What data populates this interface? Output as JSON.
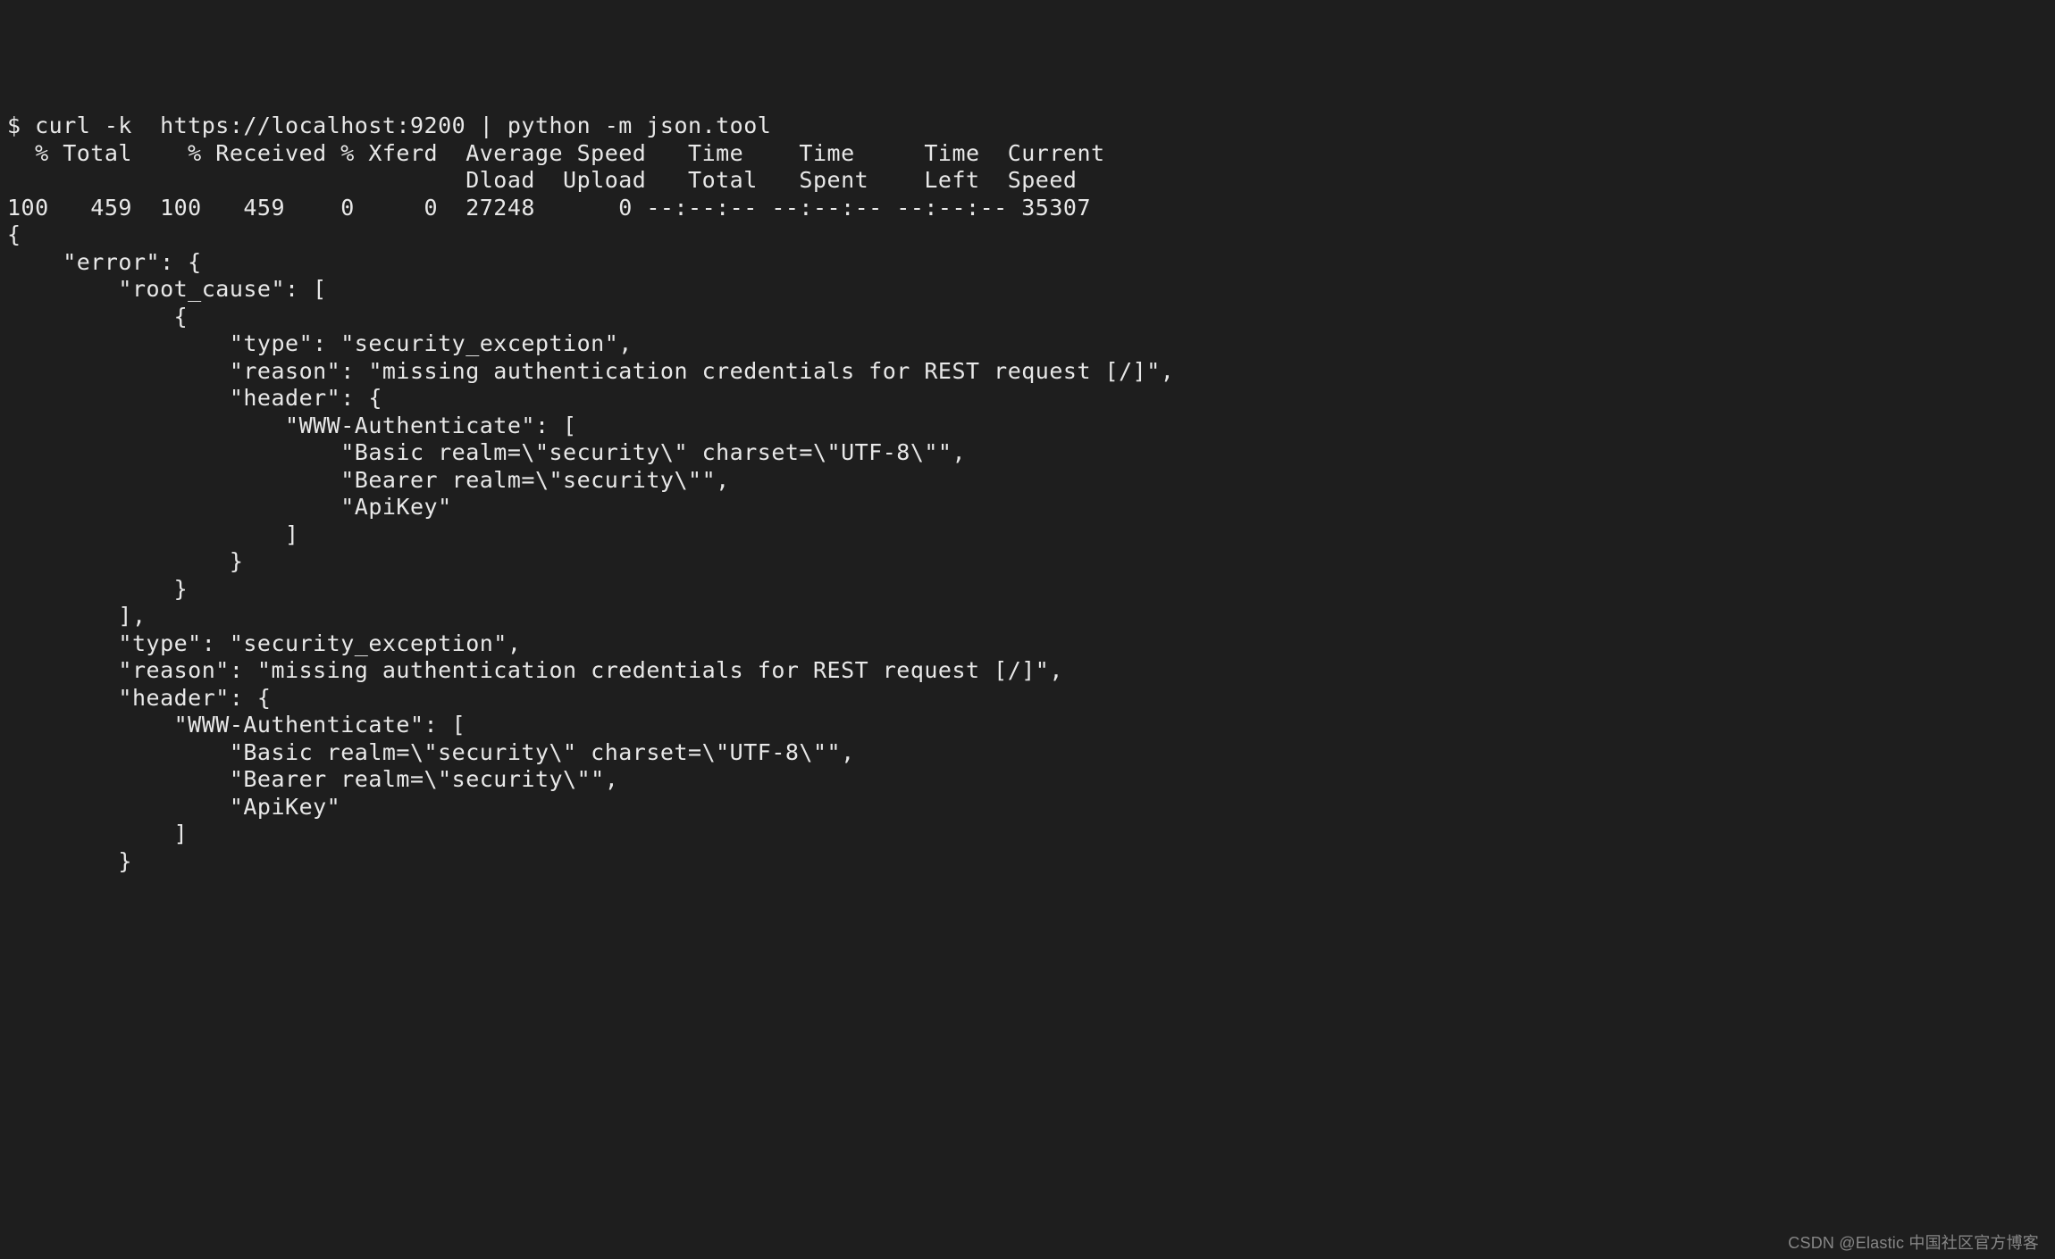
{
  "terminal": {
    "prompt": "$ ",
    "command": "curl -k  https://localhost:9200 | python -m json.tool",
    "progress_header1": "  % Total    % Received % Xferd  Average Speed   Time    Time     Time  Current",
    "progress_header2": "                                 Dload  Upload   Total   Spent    Left  Speed",
    "progress_line": "100   459  100   459    0     0  27248      0 --:--:-- --:--:-- --:--:-- 35307",
    "json_lines": [
      "{",
      "    \"error\": {",
      "        \"root_cause\": [",
      "            {",
      "                \"type\": \"security_exception\",",
      "                \"reason\": \"missing authentication credentials for REST request [/]\",",
      "                \"header\": {",
      "                    \"WWW-Authenticate\": [",
      "                        \"Basic realm=\\\"security\\\" charset=\\\"UTF-8\\\"\",",
      "                        \"Bearer realm=\\\"security\\\"\",",
      "                        \"ApiKey\"",
      "                    ]",
      "                }",
      "            }",
      "        ],",
      "        \"type\": \"security_exception\",",
      "        \"reason\": \"missing authentication credentials for REST request [/]\",",
      "        \"header\": {",
      "            \"WWW-Authenticate\": [",
      "                \"Basic realm=\\\"security\\\" charset=\\\"UTF-8\\\"\",",
      "                \"Bearer realm=\\\"security\\\"\",",
      "                \"ApiKey\"",
      "            ]",
      "        }"
    ]
  },
  "watermark": "CSDN @Elastic 中国社区官方博客"
}
